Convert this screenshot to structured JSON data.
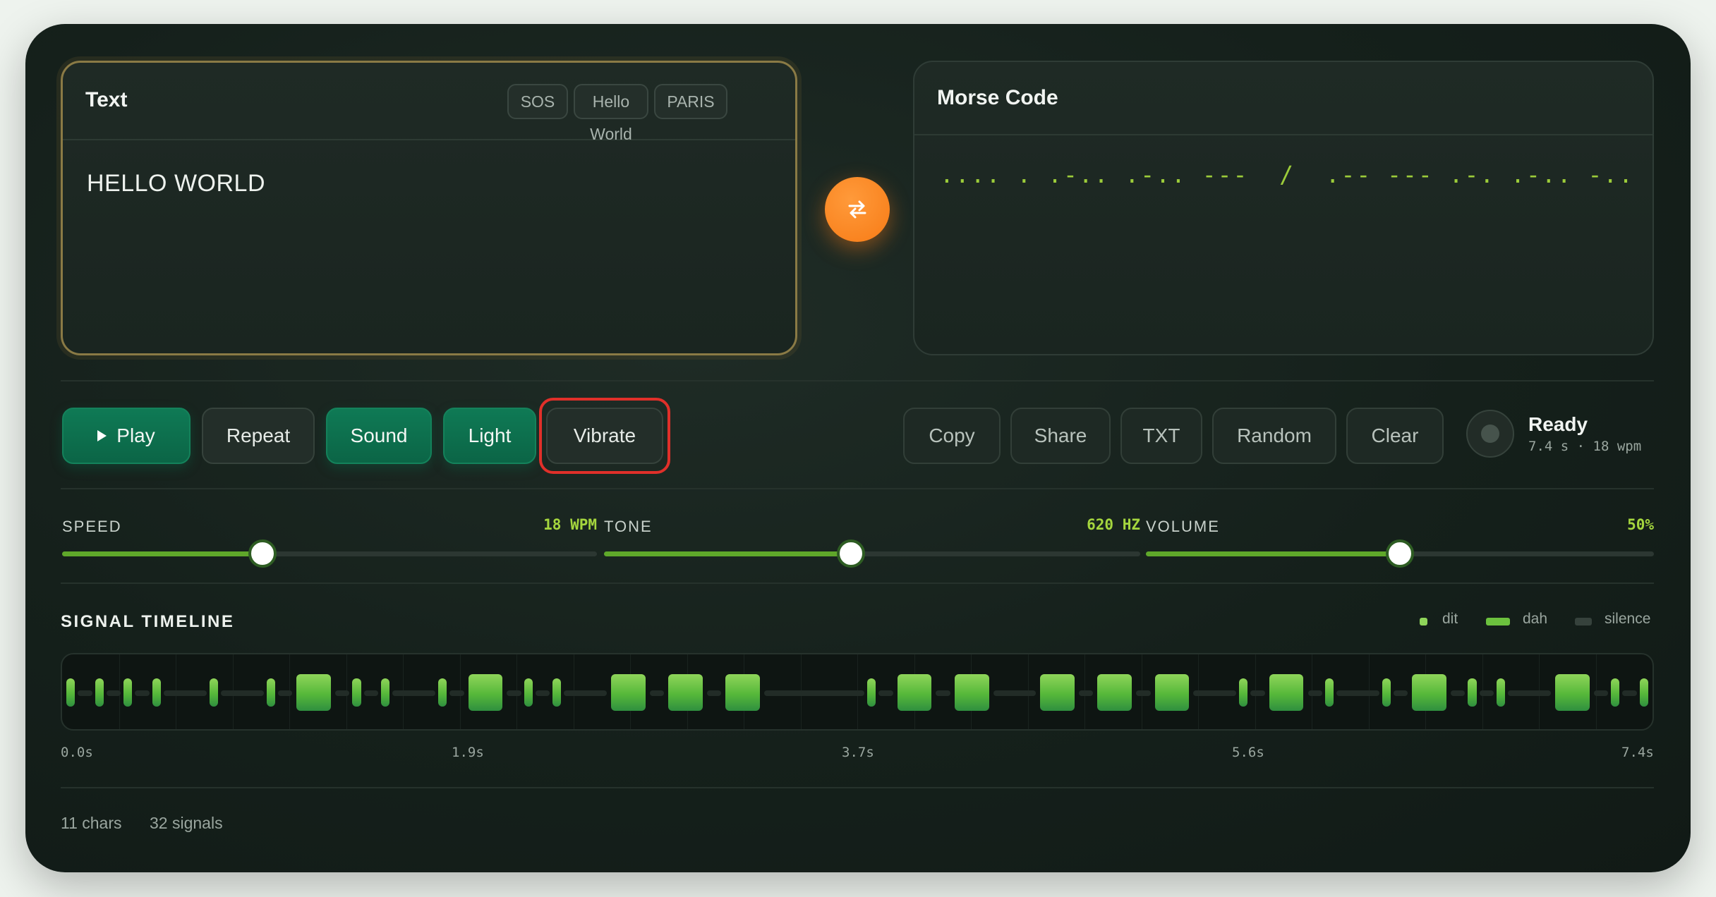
{
  "text_panel": {
    "title": "Text",
    "presets": [
      "SOS",
      "Hello World",
      "PARIS"
    ],
    "value": "HELLO WORLD"
  },
  "morse_panel": {
    "title": "Morse Code",
    "value": ".... . .-.. .-.. ---  /  .-- --- .-. .-.. -.."
  },
  "swap_button": {
    "icon": "swap-arrows-icon"
  },
  "controls": {
    "play": "Play",
    "repeat": "Repeat",
    "sound": "Sound",
    "light": "Light",
    "vibrate": "Vibrate",
    "copy": "Copy",
    "share": "Share",
    "txt": "TXT",
    "random": "Random",
    "clear": "Clear"
  },
  "status": {
    "title": "Ready",
    "subtitle": "7.4 s · 18 wpm"
  },
  "sliders": {
    "speed": {
      "label": "SPEED",
      "value": "18 WPM",
      "fraction": 0.375
    },
    "tone": {
      "label": "TONE",
      "value": "620 HZ",
      "fraction": 0.46
    },
    "volume": {
      "label": "VOLUME",
      "value": "50%",
      "fraction": 0.5
    }
  },
  "timeline": {
    "title": "SIGNAL TIMELINE",
    "legend": {
      "dit": "dit",
      "dah": "dah",
      "silence": "silence"
    },
    "ticks": [
      "0.0s",
      "1.9s",
      "3.7s",
      "5.6s",
      "7.4s"
    ],
    "total_units": 111,
    "signals": [
      [
        0,
        1
      ],
      [
        2,
        1
      ],
      [
        4,
        1
      ],
      [
        6,
        1
      ],
      [
        10,
        1
      ],
      [
        14,
        1
      ],
      [
        16,
        3
      ],
      [
        20,
        1
      ],
      [
        22,
        1
      ],
      [
        26,
        1
      ],
      [
        28,
        3
      ],
      [
        32,
        1
      ],
      [
        34,
        1
      ],
      [
        38,
        3
      ],
      [
        42,
        3
      ],
      [
        46,
        3
      ],
      [
        56,
        1
      ],
      [
        58,
        3
      ],
      [
        62,
        3
      ],
      [
        68,
        3
      ],
      [
        72,
        3
      ],
      [
        76,
        3
      ],
      [
        82,
        1
      ],
      [
        84,
        3
      ],
      [
        88,
        1
      ],
      [
        92,
        1
      ],
      [
        94,
        3
      ],
      [
        98,
        1
      ],
      [
        100,
        1
      ],
      [
        104,
        3
      ],
      [
        108,
        1
      ],
      [
        110,
        1
      ]
    ]
  },
  "footer": {
    "chars": "11 chars",
    "signals": "32 signals"
  }
}
